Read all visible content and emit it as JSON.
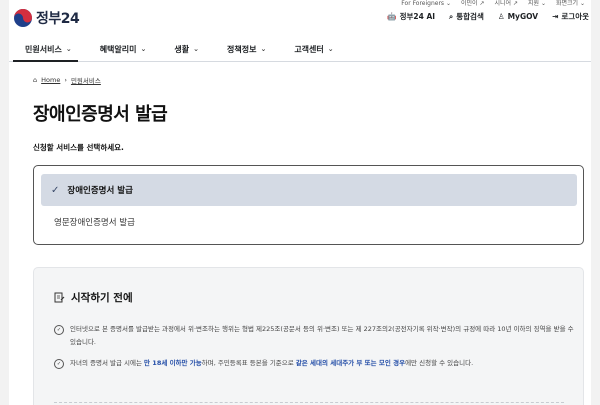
{
  "topbar": {
    "items": [
      "For Foreigners ⌄",
      "이민이 ↗",
      "시니어 ↗",
      "지원 ⌄",
      "화면크기 ⌄"
    ]
  },
  "header": {
    "logo_text": "정부24",
    "util": {
      "ai": "정부24 AI",
      "search": "통합검색",
      "mygov": "MyGOV",
      "login": "로그아웃"
    }
  },
  "gnb": {
    "items": [
      "민원서비스",
      "혜택알리미",
      "생활",
      "정책정보",
      "고객센터"
    ],
    "active_index": 0
  },
  "breadcrumb": {
    "home": "Home",
    "current": "민원서비스"
  },
  "page": {
    "title": "장애인증명서 발급",
    "subtitle": "신청할 서비스를 선택하세요.",
    "options": [
      "장애인증명서 발급",
      "영문장애인증명서 발급"
    ],
    "selected_option": 0
  },
  "info": {
    "heading": "시작하기 전에",
    "item1": "인터넷으로 본 증명서를 발급받는 과정에서 위·변조하는 행위는 형법 제225조(공문서 등의 위·변조) 또는 제 227조의2(공전자기록 위작·변작)의 규정에 따라 10년 이하의 징역을 받을 수 있습니다.",
    "item2_a": "자녀의 증명서 발급 시에는 ",
    "item2_b": "만 18세 이하만 가능",
    "item2_c": "하며, 주민등록표 등본을 기준으로 ",
    "item2_d": "같은 세대의 세대주가 부 또는 모인 경우",
    "item2_e": "에만 신청할 수 있습니다."
  },
  "colors": {
    "selected_bg": "#d4dae4",
    "highlight": "#254fa8",
    "brand": "#1f2a44"
  }
}
